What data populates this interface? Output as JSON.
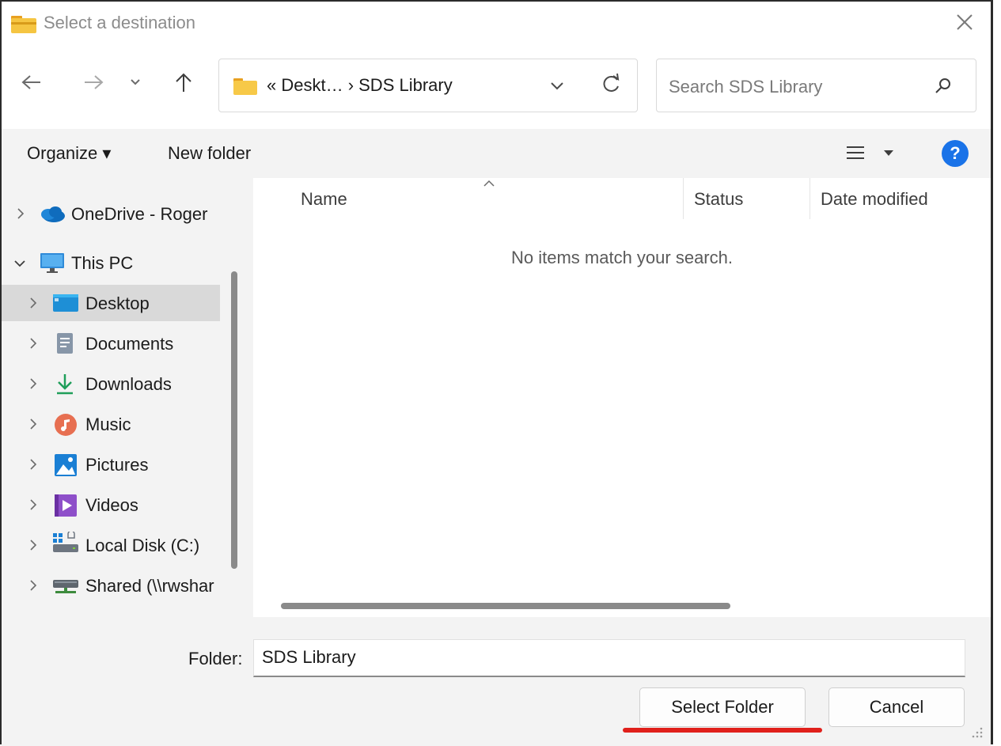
{
  "window": {
    "title": "Select a destination"
  },
  "address": {
    "path": "« Deskt… › SDS Library"
  },
  "search": {
    "placeholder": "Search SDS Library"
  },
  "toolbar": {
    "organize": "Organize ▾",
    "new_folder": "New folder",
    "help": "?"
  },
  "tree": [
    {
      "label": "OneDrive - Roger",
      "icon": "onedrive-cloud-icon",
      "chevron": "right"
    },
    {
      "label": "This PC",
      "icon": "monitor-icon",
      "chevron": "down"
    },
    {
      "label": "Desktop",
      "icon": "desktop-icon",
      "chevron": "right",
      "selected": true
    },
    {
      "label": "Documents",
      "icon": "documents-icon",
      "chevron": "right"
    },
    {
      "label": "Downloads",
      "icon": "download-arrow-icon",
      "chevron": "right"
    },
    {
      "label": "Music",
      "icon": "music-note-icon",
      "chevron": "right"
    },
    {
      "label": "Pictures",
      "icon": "pictures-icon",
      "chevron": "right"
    },
    {
      "label": "Videos",
      "icon": "videos-icon",
      "chevron": "right"
    },
    {
      "label": "Local Disk (C:)",
      "icon": "local-disk-icon",
      "chevron": "right"
    },
    {
      "label": "Shared (\\\\rwshar",
      "icon": "network-drive-icon",
      "chevron": "right"
    }
  ],
  "columns": {
    "name": "Name",
    "status": "Status",
    "date_modified": "Date modified"
  },
  "list": {
    "empty_message": "No items match your search."
  },
  "footer": {
    "folder_label": "Folder:",
    "folder_value": "SDS Library",
    "select_button": "Select Folder",
    "cancel_button": "Cancel"
  },
  "colors": {
    "accent_blue": "#1a73e8",
    "highlight_red": "#e0201b",
    "selected_row": "#d9d9d9"
  }
}
